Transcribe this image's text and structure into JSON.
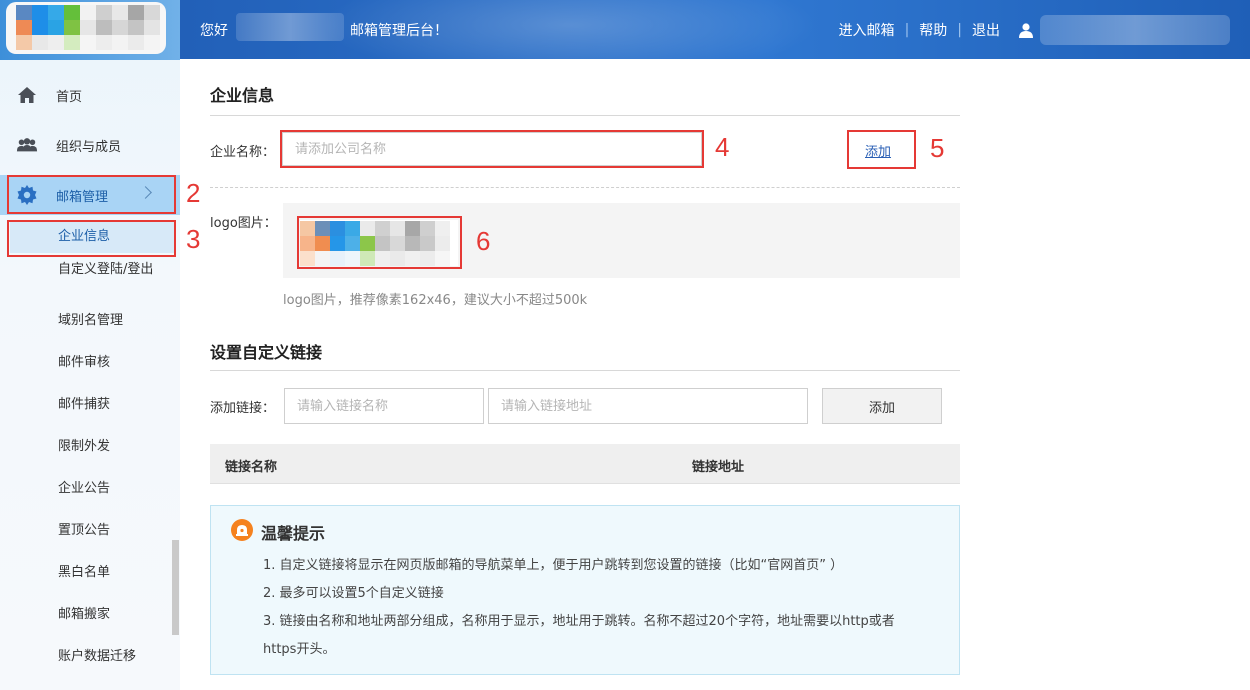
{
  "sidebar": {
    "nav": [
      {
        "label": "首页",
        "icon": "home-icon"
      },
      {
        "label": "组织与成员",
        "icon": "users-icon"
      },
      {
        "label": "邮箱管理",
        "icon": "gear-icon"
      }
    ],
    "submenu": [
      "企业信息",
      "自定义登陆/登出",
      "域别名管理",
      "邮件审核",
      "邮件捕获",
      "限制外发",
      "企业公告",
      "置顶公告",
      "黑白名单",
      "邮箱搬家",
      "账户数据迁移"
    ]
  },
  "header": {
    "welcome_prefix": "您好",
    "welcome_suffix": "邮箱管理后台！",
    "links": [
      "进入邮箱",
      "帮助",
      "退出"
    ]
  },
  "company": {
    "section_title": "企业信息",
    "name_label": "企业名称：",
    "name_placeholder": "请添加公司名称",
    "add_link": "添加",
    "logo_label": "logo图片：",
    "logo_hint": "logo图片，推荐像素162x46，建议大小不超过500k"
  },
  "links_section": {
    "title": "设置自定义链接",
    "add_label": "添加链接：",
    "name_placeholder": "请输入链接名称",
    "url_placeholder": "请输入链接地址",
    "add_button": "添加",
    "col_name": "链接名称",
    "col_url": "链接地址"
  },
  "tips": {
    "title": "温馨提示",
    "lines": [
      "1. 自定义链接将显示在网页版邮箱的导航菜单上，便于用户跳转到您设置的链接（比如“官网首页” ）",
      "2. 最多可以设置5个自定义链接",
      "3. 链接由名称和地址两部分组成，名称用于显示，地址用于跳转。名称不超过20个字符，地址需要以http或者",
      "https开头。"
    ]
  },
  "annotations": [
    "2",
    "3",
    "4",
    "5",
    "6"
  ]
}
